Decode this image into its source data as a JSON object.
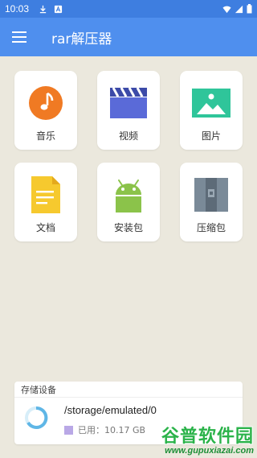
{
  "status_bar": {
    "time": "10:03"
  },
  "app_bar": {
    "title": "rar解压器"
  },
  "tiles": [
    {
      "label": "音乐",
      "icon": "music-icon"
    },
    {
      "label": "视频",
      "icon": "video-icon"
    },
    {
      "label": "图片",
      "icon": "image-icon"
    },
    {
      "label": "文档",
      "icon": "document-icon"
    },
    {
      "label": "安装包",
      "icon": "android-icon"
    },
    {
      "label": "压缩包",
      "icon": "archive-icon"
    }
  ],
  "storage": {
    "header": "存储设备",
    "path": "/storage/emulated/0",
    "used_label": "已用：10.17 GB"
  },
  "watermark": {
    "main": "谷普软件园",
    "sub": "www.gupuxiazai.com"
  },
  "colors": {
    "status_bar": "#3e7ee0",
    "app_bar": "#4f8fee",
    "background": "#ebe8dd",
    "music": "#f07a23",
    "video": "#5a6ad8",
    "image": "#2fc59a",
    "document": "#f6c92e",
    "android": "#8bc34a",
    "archive": "#7a8a98",
    "ring": "#5fb6e6",
    "used_legend": "#b9a8e6"
  }
}
